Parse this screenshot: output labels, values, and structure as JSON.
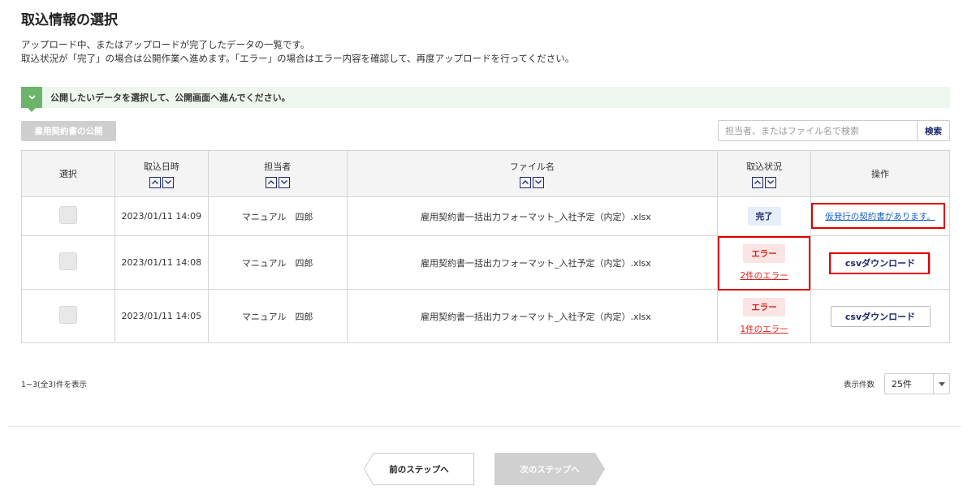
{
  "title": "取込情報の選択",
  "description": [
    "アップロード中、またはアップロードが完了したデータの一覧です。",
    "取込状況が「完了」の場合は公開作業へ進めます。「エラー」の場合はエラー内容を確認して、再度アップロードを行ってください。"
  ],
  "notice": {
    "icon": "chevron-down-icon",
    "text": "公開したいデータを選択して、公開画面へ進んでください。"
  },
  "publish_button": "雇用契約書の公開",
  "search": {
    "placeholder": "担当者、またはファイル名で検索",
    "button": "検索"
  },
  "columns": {
    "select": "選択",
    "date": "取込日時",
    "person": "担当者",
    "file": "ファイル名",
    "status": "取込状況",
    "action": "操作"
  },
  "sort_icons": {
    "up": "^",
    "down": "v"
  },
  "rows": [
    {
      "date": "2023/01/11 14:09",
      "person": "マニュアル　四郎",
      "file": "雇用契約書一括出力フォーマット_入社予定（内定）.xlsx",
      "status": "完了",
      "error_link": "",
      "action": "仮発行の契約書があります。"
    },
    {
      "date": "2023/01/11 14:08",
      "person": "マニュアル　四郎",
      "file": "雇用契約書一括出力フォーマット_入社予定（内定）.xlsx",
      "status": "エラー",
      "error_link": "2件のエラー",
      "action": "csvダウンロード"
    },
    {
      "date": "2023/01/11 14:05",
      "person": "マニュアル　四郎",
      "file": "雇用契約書一括出力フォーマット_入社予定（内定）.xlsx",
      "status": "エラー",
      "error_link": "1件のエラー",
      "action": "csvダウンロード"
    }
  ],
  "pagination": {
    "count_text": "1~3(全3)件を表示",
    "per_page_label": "表示件数",
    "per_page_value": "25件"
  },
  "steps": {
    "prev": "前のステップへ",
    "next": "次のステップへ"
  },
  "colors": {
    "navy": "#1d2a6b",
    "error": "#d9231b",
    "notice_green": "#6cb46c",
    "highlight": "#e00000"
  }
}
